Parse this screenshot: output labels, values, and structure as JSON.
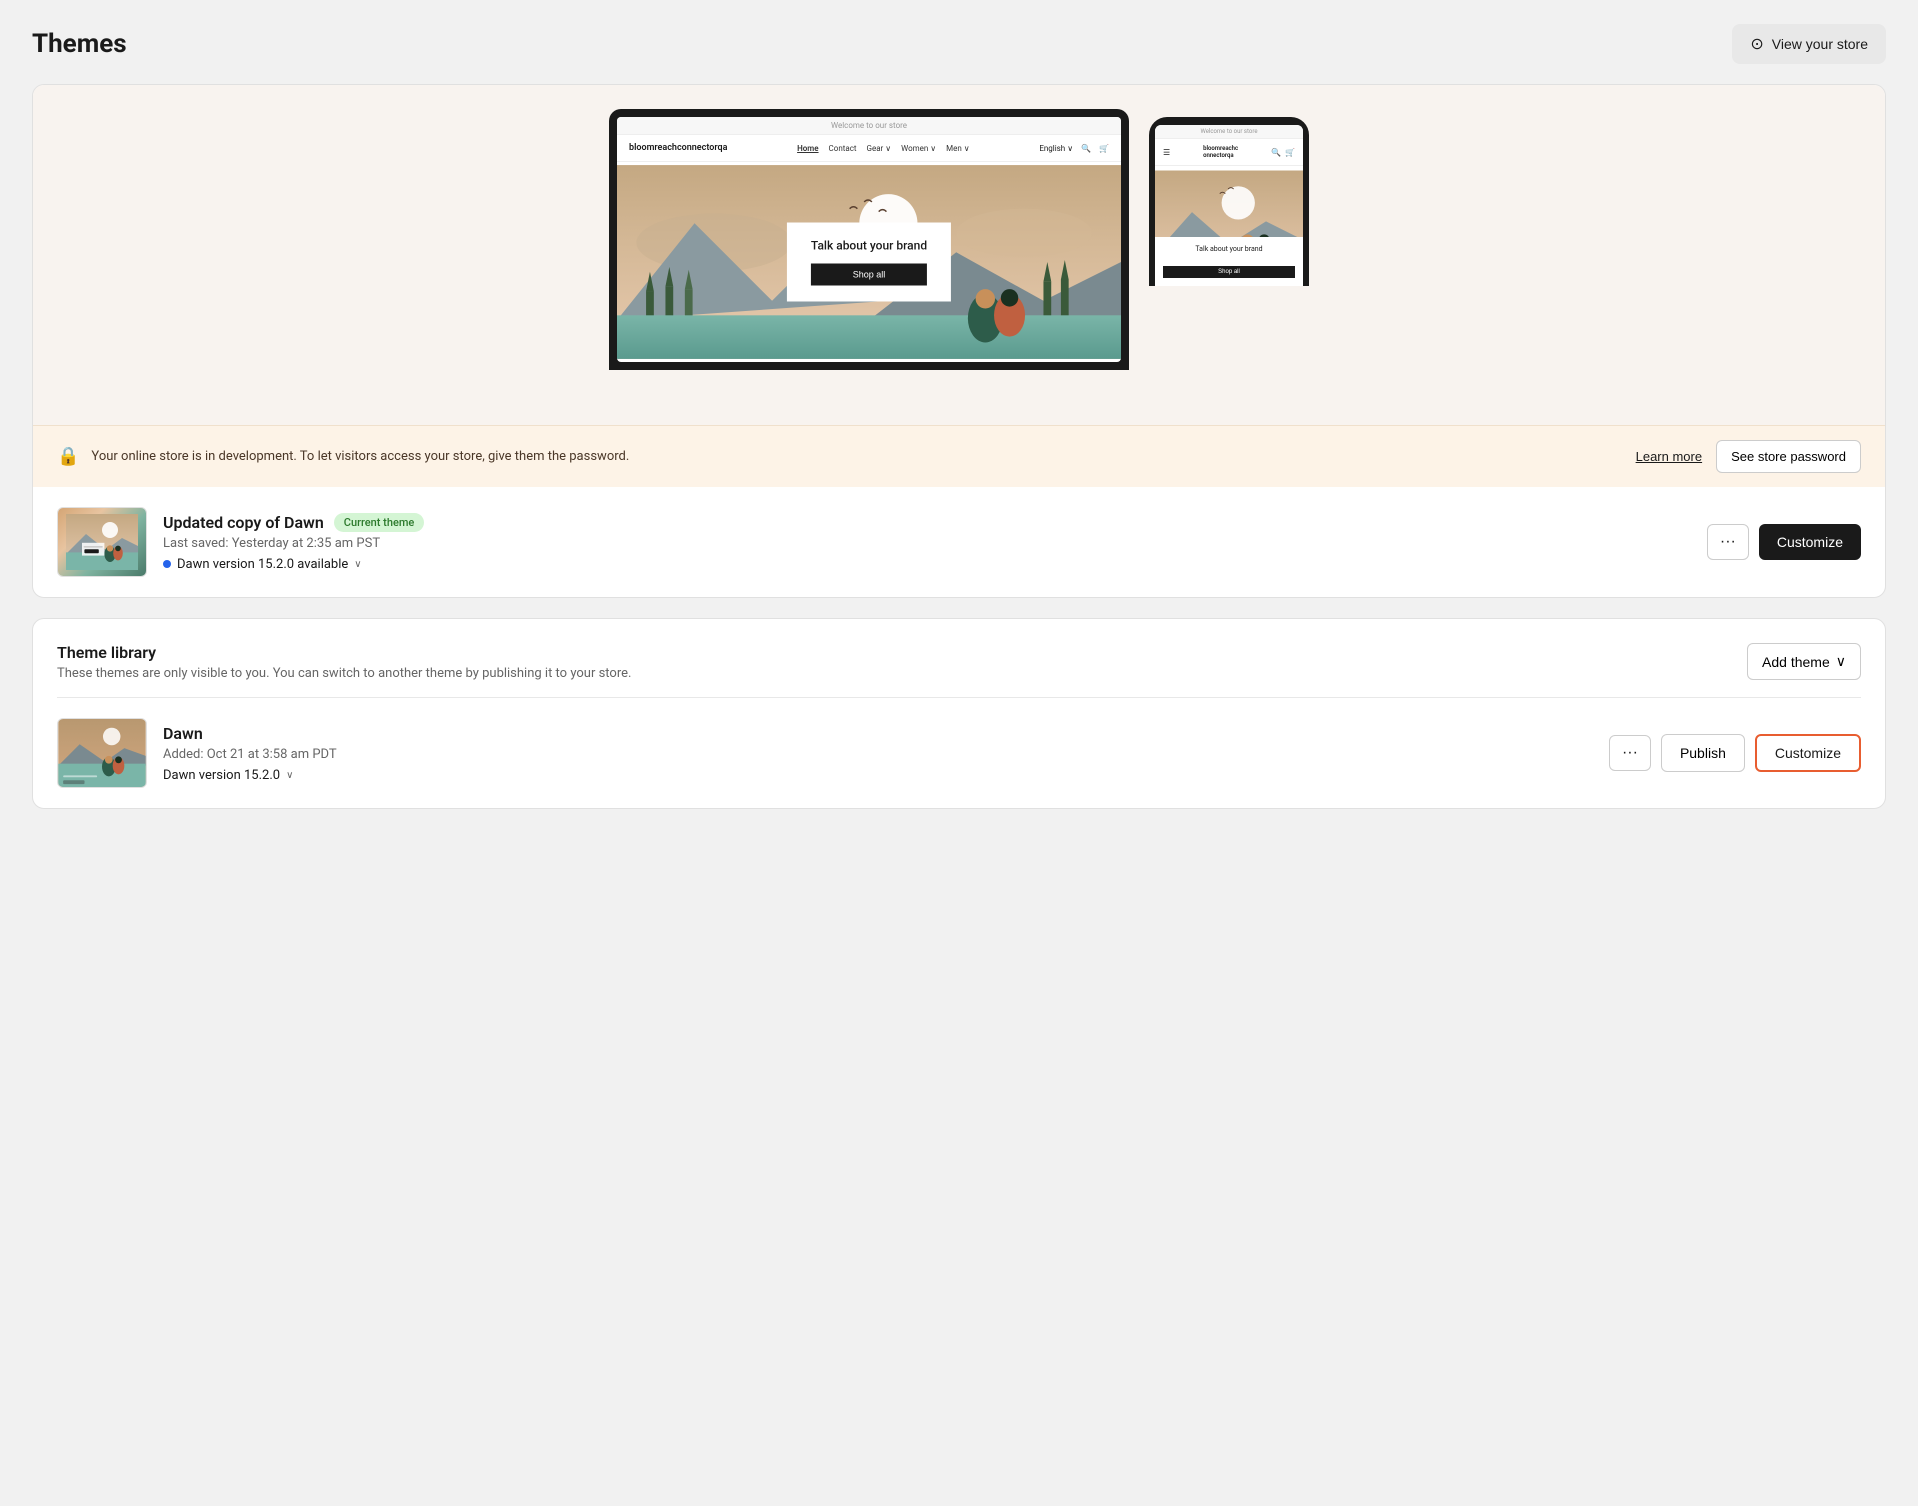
{
  "header": {
    "title": "Themes",
    "view_store_label": "View your store"
  },
  "current_theme_preview": {
    "store_url_label": "Welcome to our store",
    "store_name": "bloomreachconnectorqa",
    "nav_links": [
      "Home",
      "Contact",
      "Gear",
      "Women",
      "Men"
    ],
    "nav_language": "English",
    "hero_text": "Talk about your brand",
    "shop_all_label": "Shop all",
    "mobile_store_name": "bloomreachc\nonnectorqa"
  },
  "password_banner": {
    "text": "Your online store is in development. To let visitors access your store, give them the password.",
    "learn_more_label": "Learn more",
    "see_password_label": "See store password"
  },
  "current_theme": {
    "name": "Updated copy of Dawn",
    "badge": "Current theme",
    "last_saved": "Last saved: Yesterday at 2:35 am PST",
    "version_text": "Dawn version 15.2.0 available",
    "more_label": "···",
    "customize_label": "Customize"
  },
  "theme_library": {
    "title": "Theme library",
    "description": "These themes are only visible to you. You can switch to another theme by publishing it to your store.",
    "add_theme_label": "Add theme",
    "themes": [
      {
        "name": "Dawn",
        "added": "Added: Oct 21 at 3:58 am PDT",
        "version": "Dawn version 15.2.0",
        "more_label": "···",
        "publish_label": "Publish",
        "customize_label": "Customize"
      }
    ]
  }
}
